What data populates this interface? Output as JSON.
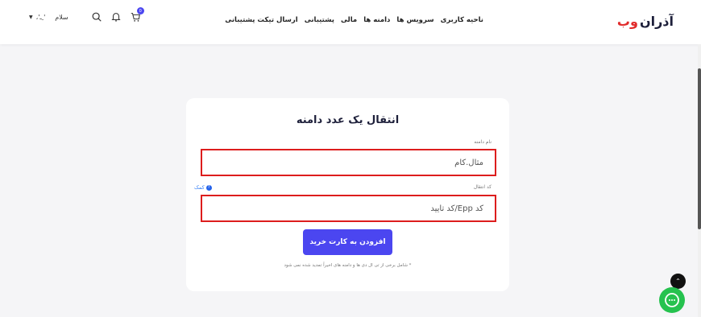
{
  "brand": {
    "part1": "آذران",
    "part2": "وب",
    "accent": "#e12b2b"
  },
  "nav": {
    "items": [
      "ناحیه کاربری",
      "سرویس ها",
      "دامنه ها",
      "مالی",
      "پشتیبانی",
      "ارسال تیکت پشتیبانی"
    ]
  },
  "header_left": {
    "greeting": "سلام",
    "username": "،'ـ ِ'",
    "icons": [
      "search-icon",
      "bell-icon",
      "cart-icon"
    ],
    "cart_count": "0"
  },
  "form": {
    "title": "انتقال یک عدد دامنه",
    "domain_label": "نام دامنه",
    "domain_placeholder": "مثال.کام",
    "code_label": "کد انتقال",
    "help_text": "کمک",
    "code_placeholder": "کد Epp/کد تأیید",
    "submit_label": "افزودن به کارت خرید",
    "note": "* شامل برخی از تی ال دی ها و دامنه های اخیراً تمدید شده نمی شود"
  },
  "colors": {
    "primary": "#4b46f0",
    "highlight_border": "#dd1d1d",
    "chat": "#26c24f"
  }
}
